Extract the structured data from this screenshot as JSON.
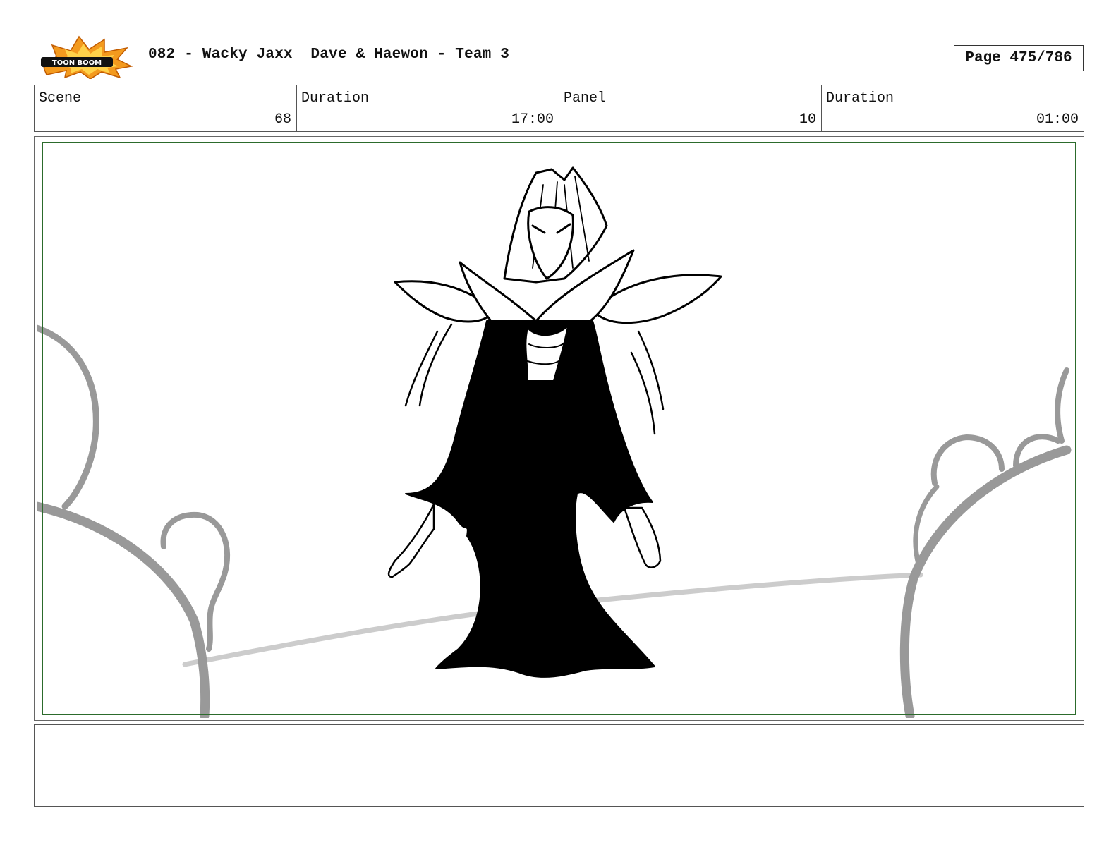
{
  "header": {
    "logo_text": "TOON BOOM",
    "title": "082 - Wacky Jaxx  Dave & Haewon - Team 3",
    "page": "Page 475/786"
  },
  "info": {
    "scene_label": "Scene",
    "scene_value": "68",
    "duration_label": "Duration",
    "duration_value": "17:00",
    "panel_label": "Panel",
    "panel_value": "10",
    "panel_duration_label": "Duration",
    "panel_duration_value": "01:00"
  },
  "notes": {
    "text": ""
  },
  "colors": {
    "safe_frame": "#2c6b2c",
    "background_lines": "#999999",
    "ground_line": "#cccccc",
    "figure": "#000000"
  }
}
